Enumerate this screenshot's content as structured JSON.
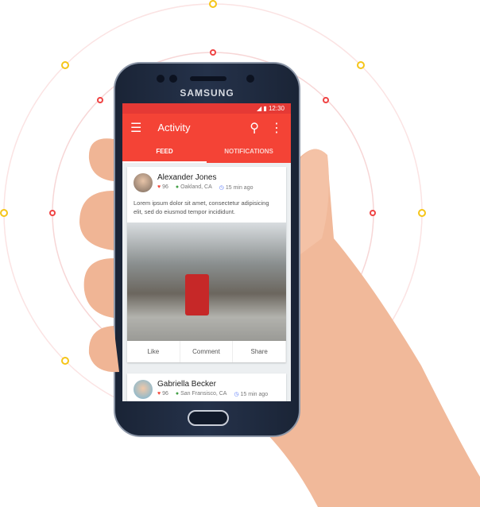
{
  "device": {
    "brand": "SAMSUNG"
  },
  "status_bar": {
    "time": "12:30"
  },
  "app_bar": {
    "title": "Activity",
    "icons": [
      "menu-icon",
      "search-icon",
      "more-vert-icon"
    ]
  },
  "tabs": [
    {
      "label": "FEED",
      "active": true
    },
    {
      "label": "NOTIFICATIONS",
      "active": false
    }
  ],
  "posts": [
    {
      "author": "Alexander Jones",
      "likes": "96",
      "location": "Oakland, CA",
      "time": "15 min ago",
      "text": "Lorem ipsum dolor sit amet, consectetur adipisicing elit, sed do eiusmod tempor incididunt.",
      "actions": [
        "Like",
        "Comment",
        "Share"
      ]
    },
    {
      "author": "Gabriella Becker",
      "likes": "96",
      "location": "San Fransisco, CA",
      "time": "15 min ago"
    }
  ],
  "colors": {
    "primary": "#f44336",
    "status": "#e53935",
    "heart": "#f44336",
    "pin": "#43a047",
    "clock": "#5c7cfa"
  }
}
